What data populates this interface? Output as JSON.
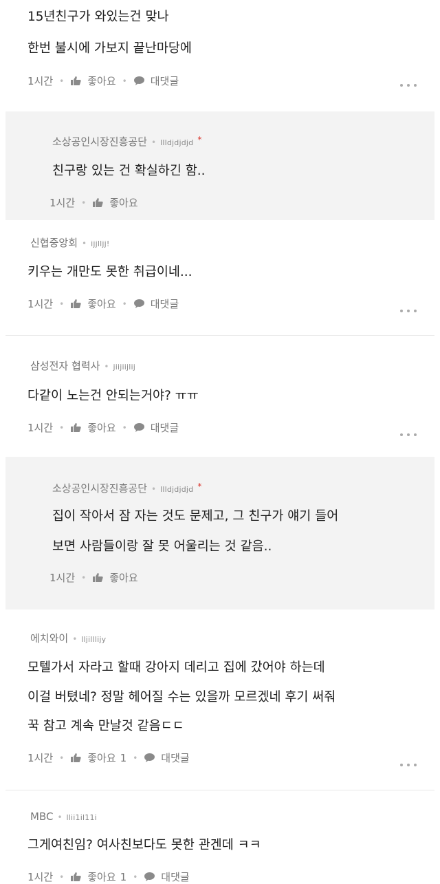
{
  "comments": [
    {
      "lines": [
        "15년친구가 와있는건 맞나",
        "한번 불시에 가보지 끝난마당에"
      ],
      "time": "1시간",
      "like_label": "좋아요",
      "reply_label": "대댓글"
    },
    {
      "org": "소상공인시장진흥공단",
      "user_id": "llldjdjdjd",
      "badge": "*",
      "lines": [
        "친구랑 있는 건 확실하긴 함.."
      ],
      "time": "1시간",
      "like_label": "좋아요"
    },
    {
      "org": "신협중앙회",
      "user_id": "ijjlljj!",
      "lines": [
        "키우는 개만도 못한 취급이네..."
      ],
      "time": "1시간",
      "like_label": "좋아요",
      "reply_label": "대댓글"
    },
    {
      "org": "삼성전자 협력사",
      "user_id": "jiijiijlij",
      "lines": [
        "다같이 노는건 안되는거야? ㅠㅠ"
      ],
      "time": "1시간",
      "like_label": "좋아요",
      "reply_label": "대댓글"
    },
    {
      "org": "소상공인시장진흥공단",
      "user_id": "llldjdjdjd",
      "badge": "*",
      "lines": [
        "집이 작아서 잠 자는 것도 문제고, 그 친구가 얘기 들어",
        "보면 사람들이랑 잘 못 어울리는 것 같음.."
      ],
      "time": "1시간",
      "like_label": "좋아요"
    },
    {
      "org": "에치와이",
      "user_id": "lljilllijy",
      "lines": [
        "모텔가서 자라고 할때 강아지 데리고 집에 갔어야 하는데",
        "이걸 버텼네? 정말 헤어질 수는 있을까 모르겠네 후기 써줘",
        "꾹 참고 계속 만날것 같음ㄷㄷ"
      ],
      "time": "1시간",
      "like_label": "좋아요",
      "like_count": "1",
      "reply_label": "대댓글"
    },
    {
      "org": "MBC",
      "user_id": "llii1il11i",
      "lines": [
        "그게여친임? 여사친보다도 못한 관겐데 ㅋㅋ"
      ],
      "time": "1시간",
      "like_label": "좋아요",
      "like_count": "1",
      "reply_label": "대댓글"
    }
  ],
  "icons": {
    "like": "thumbs-up-icon",
    "reply": "speech-bubble-icon",
    "more": "more-dots-icon"
  },
  "colors": {
    "reply_bg": "#f3f3f3",
    "badge": "#d9342b",
    "meta_text": "#777777"
  }
}
